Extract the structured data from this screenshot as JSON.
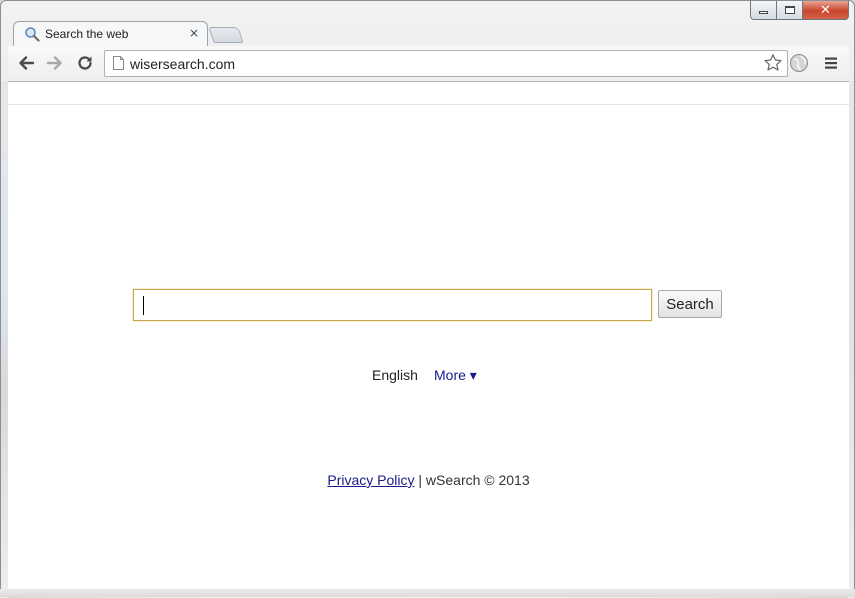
{
  "browser": {
    "tab": {
      "title": "Search the web",
      "close": "×",
      "favicon": "magnifier-icon"
    },
    "address_bar": {
      "url": "wisersearch.com"
    },
    "window_controls": {
      "close": "✕"
    }
  },
  "page": {
    "search": {
      "value": "",
      "button_label": "Search"
    },
    "language": {
      "current": "English",
      "more_label": "More ▾"
    },
    "footer": {
      "privacy_label": "Privacy Policy",
      "separator": " | ",
      "copyright": "wSearch © 2013"
    }
  },
  "colors": {
    "link": "#1a1a8c",
    "input_border": "#c9a44f",
    "close_button": "#c9462c"
  }
}
